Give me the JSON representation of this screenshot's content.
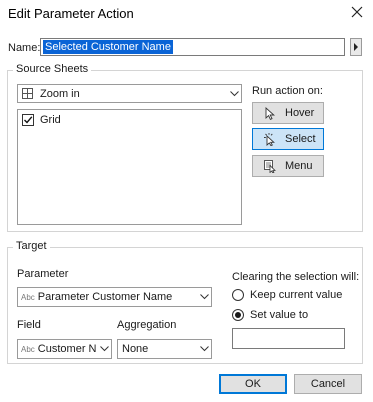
{
  "dialog": {
    "title": "Edit Parameter Action"
  },
  "name": {
    "label": "Name:",
    "value": "Selected Customer Name"
  },
  "source_sheets": {
    "title": "Source Sheets",
    "data_source": "Zoom in",
    "sheets": [
      {
        "label": "Grid",
        "checked": true
      }
    ]
  },
  "run_action": {
    "label": "Run action on:",
    "options": [
      {
        "label": "Hover",
        "icon": "cursor-arrow-icon",
        "selected": false
      },
      {
        "label": "Select",
        "icon": "cursor-select-icon",
        "selected": true
      },
      {
        "label": "Menu",
        "icon": "menu-cursor-icon",
        "selected": false
      }
    ]
  },
  "target": {
    "title": "Target",
    "parameter_label": "Parameter",
    "parameter_value": "Parameter Customer Name",
    "field_label": "Field",
    "field_value": "Customer N...",
    "aggregation_label": "Aggregation",
    "aggregation_value": "None",
    "type_badge": "Abc"
  },
  "clearing": {
    "label": "Clearing the selection will:",
    "options": [
      {
        "label": "Keep current value",
        "selected": false
      },
      {
        "label": "Set value to",
        "selected": true
      }
    ],
    "set_value": ""
  },
  "footer": {
    "ok": "OK",
    "cancel": "Cancel"
  },
  "colors": {
    "accent": "#0078d7",
    "selection": "#0a64d6",
    "selected_button": "#cce4f7"
  }
}
